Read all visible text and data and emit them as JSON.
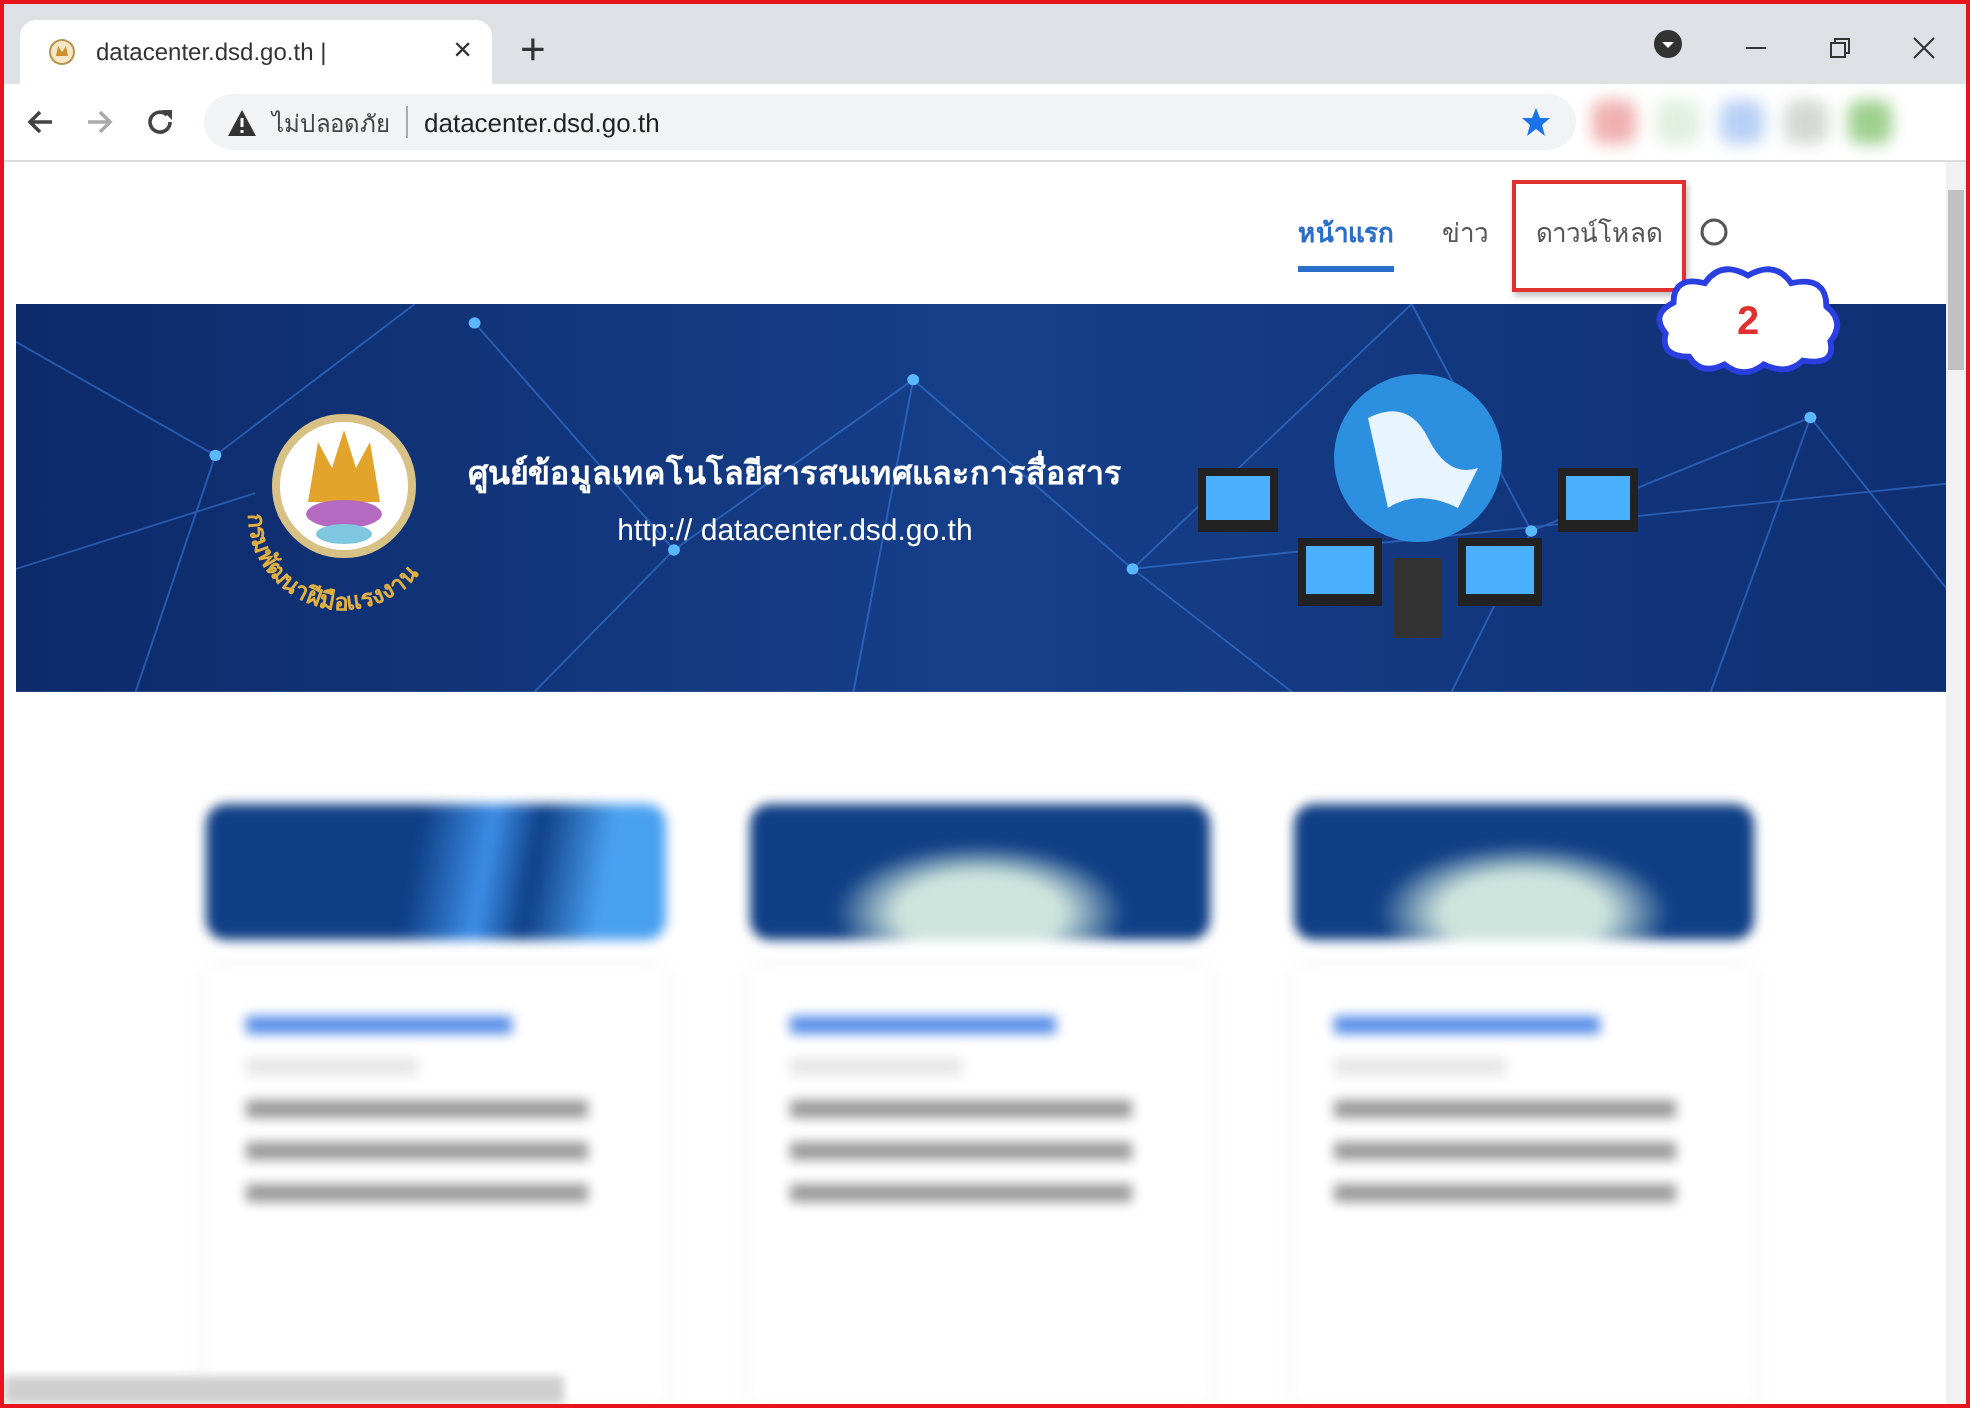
{
  "browser": {
    "tab": {
      "title": "datacenter.dsd.go.th |",
      "close": "×"
    },
    "new_tab": "+",
    "security_label": "ไม่ปลอดภัย",
    "address": "datacenter.dsd.go.th",
    "bookmarked": true
  },
  "nav": {
    "items": [
      {
        "label": "หน้าแรก",
        "selected": true,
        "marked": false
      },
      {
        "label": "ข่าว",
        "selected": false,
        "marked": false
      },
      {
        "label": "ดาวน์โหลด",
        "selected": false,
        "marked": true
      }
    ]
  },
  "callout": {
    "label": "2"
  },
  "banner": {
    "seal_text": "กรมพัฒนาฝีมือแรงงาน",
    "title": "ศูนย์ข้อมูลเทคโนโลยีสารสนเทศและการสื่อสาร",
    "url": "http:// datacenter.dsd.go.th"
  },
  "cards": [
    {
      "kind": "network"
    },
    {
      "kind": "cloud"
    },
    {
      "kind": "cloud"
    }
  ]
}
